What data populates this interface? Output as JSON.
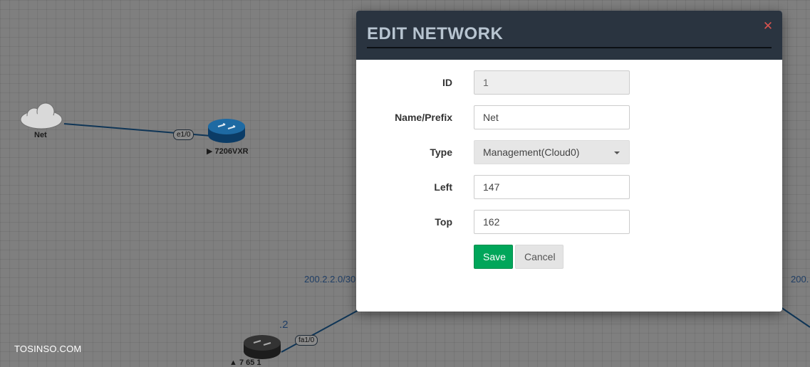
{
  "canvas": {
    "nodes": [
      {
        "label": "Net",
        "icon": "cloud-icon"
      },
      {
        "label": "▶ 7206VXR",
        "icon": "router-icon"
      },
      {
        "label": "▲ 7 65 1",
        "icon": "router-icon"
      }
    ],
    "interfaces": [
      "e1/0",
      "fa1/0"
    ],
    "subnets": [
      "200.2.2.0/30",
      "200."
    ],
    "misc_labels": [
      ".2"
    ]
  },
  "watermark": "TOSINSO.COM",
  "modal": {
    "title": "EDIT NETWORK",
    "close_icon": "close-icon",
    "fields": {
      "id": {
        "label": "ID",
        "value": "1"
      },
      "name": {
        "label": "Name/Prefix",
        "value": "Net"
      },
      "type": {
        "label": "Type",
        "value": "Management(Cloud0)"
      },
      "left": {
        "label": "Left",
        "value": "147"
      },
      "top": {
        "label": "Top",
        "value": "162"
      }
    },
    "buttons": {
      "save": "Save",
      "cancel": "Cancel"
    }
  },
  "colors": {
    "header_bg": "#2a3440",
    "title_text": "#b7c4d0",
    "save_button": "#00a65a",
    "close_icon": "#d9534f",
    "link_line": "#0f3556"
  }
}
